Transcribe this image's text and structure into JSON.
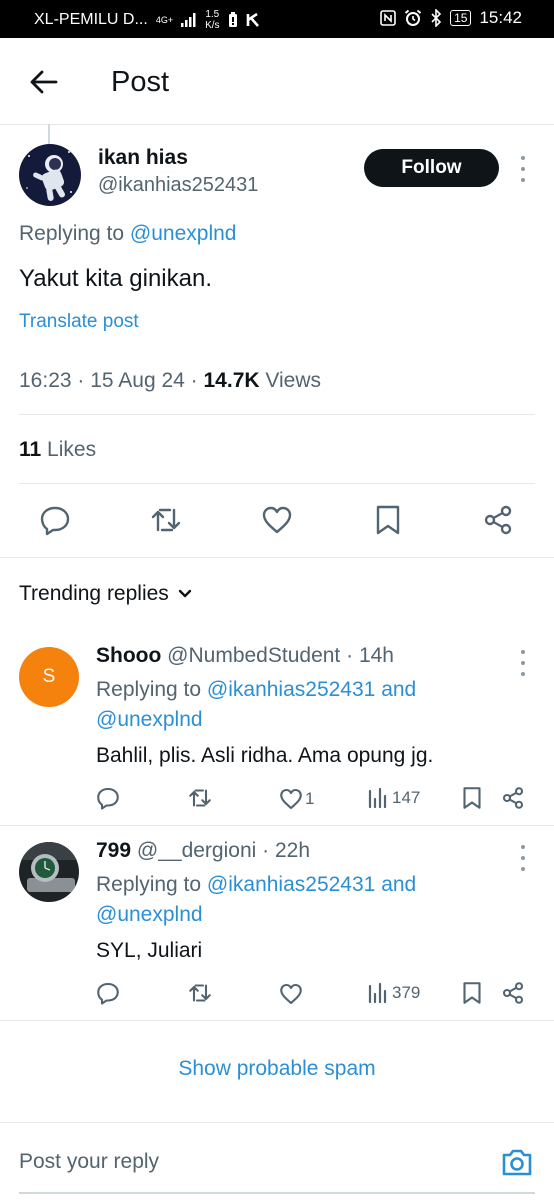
{
  "status_bar": {
    "carrier": "XL-PEMILU D...",
    "network": "4G+",
    "speed_value": "1.5",
    "speed_unit": "K/s",
    "battery": "15",
    "time": "15:42"
  },
  "header": {
    "title": "Post"
  },
  "post": {
    "author_name": "ikan hias",
    "author_handle": "@ikanhias252431",
    "follow_label": "Follow",
    "replying_prefix": "Replying to",
    "replying_to": "@unexplnd",
    "text": "Yakut kita ginikan.",
    "translate_label": "Translate post",
    "time": "16:23",
    "date": "15 Aug 24",
    "views_count": "14.7K",
    "views_label": "Views",
    "likes_count": "11",
    "likes_label": "Likes"
  },
  "trending": {
    "label": "Trending replies"
  },
  "replies": [
    {
      "avatar_letter": "S",
      "name": "Shooo",
      "handle": "@NumbedStudent",
      "age": "14h",
      "replying_prefix": "Replying to",
      "replying_to_1": "@ikanhias252431",
      "and": "and",
      "replying_to_2": "@unexplnd",
      "text": "Bahlil, plis. Asli ridha. Ama opung jg.",
      "likes": "1",
      "views": "147"
    },
    {
      "name": "799",
      "handle": "@__dergioni",
      "age": "22h",
      "replying_prefix": "Replying to",
      "replying_to_1": "@ikanhias252431",
      "and": "and",
      "replying_to_2": "@unexplnd",
      "text": "SYL, Juliari",
      "likes": "",
      "views": "379"
    }
  ],
  "spam": {
    "label": "Show probable spam"
  },
  "composer": {
    "placeholder": "Post your reply"
  },
  "colors": {
    "accent": "#2b8fd6",
    "text": "#0f1419",
    "secondary": "#536471",
    "follow_bg": "#0f1419",
    "avatar_s": "#f4820c"
  }
}
